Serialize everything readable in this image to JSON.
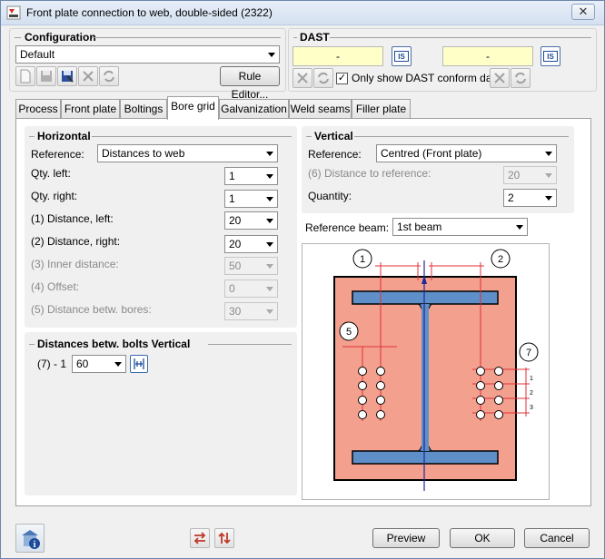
{
  "window": {
    "title": "Front plate connection to web, double-sided (2322)",
    "close_label": "✕"
  },
  "configuration": {
    "title": "Configuration",
    "selected": "Default",
    "rule_editor_label": "Rule Editor..."
  },
  "dast": {
    "title": "DAST",
    "field1": "-",
    "field2": "-",
    "is_label": "IS",
    "conform_label": "Only show DAST conform data",
    "conform_checked": true
  },
  "tabs": [
    "Process",
    "Front plate",
    "Boltings",
    "Bore grid",
    "Galvanization",
    "Weld seams",
    "Filler plate"
  ],
  "active_tab": "Bore grid",
  "horizontal": {
    "title": "Horizontal",
    "reference_label": "Reference:",
    "reference_value": "Distances to web",
    "qty_left_label": "Qty. left:",
    "qty_left_value": "1",
    "qty_right_label": "Qty. right:",
    "qty_right_value": "1",
    "dist_left_label": "(1) Distance, left:",
    "dist_left_value": "20",
    "dist_right_label": "(2) Distance, right:",
    "dist_right_value": "20",
    "inner_label": "(3) Inner distance:",
    "inner_value": "50",
    "offset_label": "(4) Offset:",
    "offset_value": "0",
    "betw_label": "(5) Distance betw. bores:",
    "betw_value": "30"
  },
  "vertical": {
    "title": "Vertical",
    "reference_label": "Reference:",
    "reference_value": "Centred (Front plate)",
    "dist_ref_label": "(6) Distance to reference:",
    "dist_ref_value": "20",
    "quantity_label": "Quantity:",
    "quantity_value": "2"
  },
  "reference_beam": {
    "label": "Reference beam:",
    "value": "1st beam"
  },
  "bolts_vertical": {
    "title": "Distances betw. bolts Vertical",
    "row_label": "(7) - 1",
    "row_value": "60"
  },
  "drawing": {
    "callouts": [
      "1",
      "2",
      "5",
      "7"
    ],
    "row_numbers": [
      "1",
      "2",
      "3"
    ]
  },
  "buttons": {
    "preview": "Preview",
    "ok": "OK",
    "cancel": "Cancel"
  },
  "colors": {
    "plate": "#f4a08e",
    "beam": "#5e8fc8",
    "dim_line": "#e0303a",
    "accent": "#c0392b"
  }
}
